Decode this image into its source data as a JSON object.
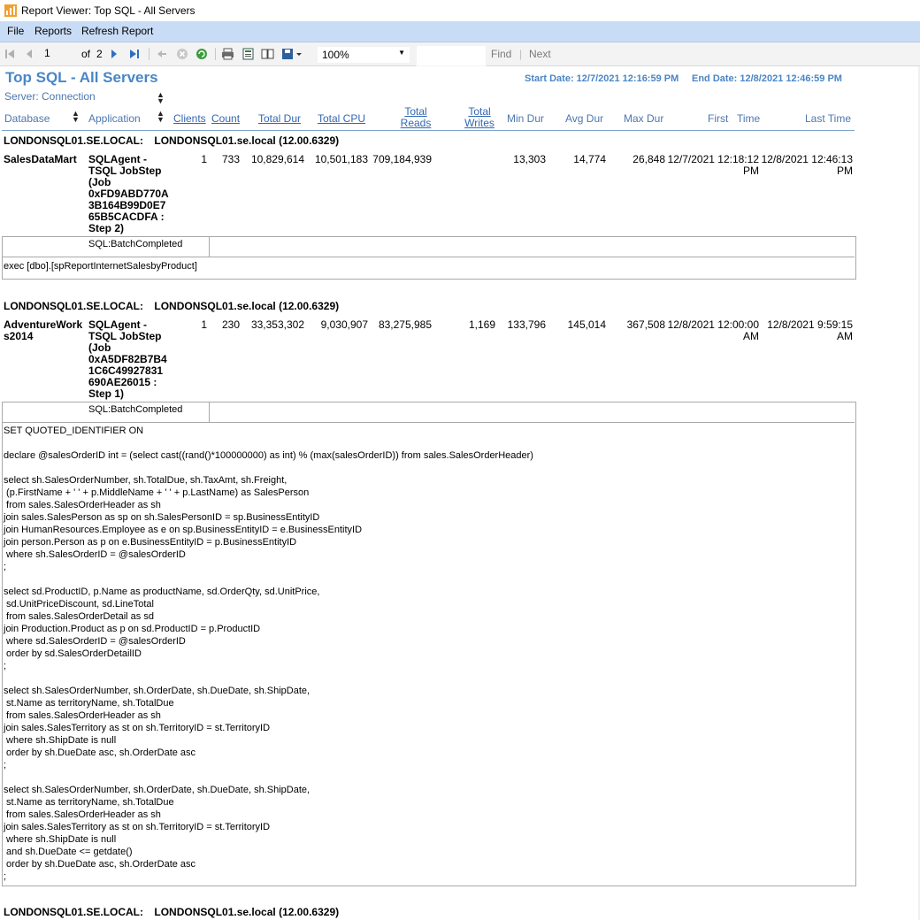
{
  "window": {
    "title": "Report Viewer: Top SQL - All Servers"
  },
  "menu": {
    "file": "File",
    "reports": "Reports",
    "refresh": "Refresh Report"
  },
  "toolbar": {
    "page_value": "1",
    "of_label": "of",
    "page_total": "2",
    "zoom": "100%",
    "find_value": "",
    "find": "Find",
    "sep": "|",
    "next": "Next",
    "icons": [
      "first-page-icon",
      "previous-page-icon",
      "next-page-icon",
      "last-page-icon",
      "back-icon",
      "stop-icon",
      "refresh-icon",
      "print-icon",
      "print-layout-icon",
      "page-setup-icon",
      "export-icon"
    ]
  },
  "report": {
    "title": "Top SQL - All Servers",
    "start_date": "Start Date: 12/7/2021 12:16:59 PM",
    "end_date": "End Date: 12/8/2021 12:46:59 PM",
    "server_header": "Server: Connection",
    "columns": {
      "database": "Database",
      "application": "Application",
      "clients": "Clients",
      "count": "Count",
      "total_dur": "Total Dur",
      "total_cpu": "Total CPU",
      "total_reads": [
        "Total",
        "Reads"
      ],
      "total_writes": [
        "Total",
        "Writes"
      ],
      "min_dur": "Min Dur",
      "avg_dur": "Avg Dur",
      "max_dur": "Max Dur",
      "first_time": [
        "First",
        "Time"
      ],
      "last_time": "Last Time"
    },
    "groups": [
      {
        "server": "LONDONSQL01.SE.LOCAL:",
        "connection": "LONDONSQL01.se.local (12.00.6329)",
        "database": "SalesDataMart",
        "application": [
          "SQLAgent -",
          "TSQL JobStep",
          "(Job",
          "0xFD9ABD770A",
          "3B164B99D0E7",
          "65B5CACDFA :",
          "Step 2)"
        ],
        "clients": "1",
        "count": "733",
        "total_dur": "10,829,614",
        "total_cpu": "10,501,183",
        "total_reads": "709,184,939",
        "total_writes": "",
        "min_dur": "13,303",
        "avg_dur": "14,774",
        "max_dur": "26,848",
        "first_time": [
          "12/7/2021 12:18:12",
          "PM"
        ],
        "last_time": [
          "12/8/2021 12:46:13",
          "PM"
        ],
        "event": "SQL:BatchCompleted",
        "sql": "exec [dbo].[spReportInternetSalesbyProduct]"
      },
      {
        "server": "LONDONSQL01.SE.LOCAL:",
        "connection": "LONDONSQL01.se.local (12.00.6329)",
        "database": [
          "AdventureWork",
          "s2014"
        ],
        "application": [
          "SQLAgent -",
          "TSQL JobStep",
          "(Job",
          "0xA5DF82B7B4",
          "1C6C49927831",
          "690AE26015 :",
          "Step 1)"
        ],
        "clients": "1",
        "count": "230",
        "total_dur": "33,353,302",
        "total_cpu": "9,030,907",
        "total_reads": "83,275,985",
        "total_writes": "1,169",
        "min_dur": "133,796",
        "avg_dur": "145,014",
        "max_dur": "367,508",
        "first_time": [
          "12/8/2021 12:00:00",
          "AM"
        ],
        "last_time": [
          "12/8/2021 9:59:15",
          "AM"
        ],
        "event": "SQL:BatchCompleted",
        "sql": "SET QUOTED_IDENTIFIER ON\n\ndeclare @salesOrderID int = (select cast((rand()*100000000) as int) % (max(salesOrderID)) from sales.SalesOrderHeader)\n\nselect sh.SalesOrderNumber, sh.TotalDue, sh.TaxAmt, sh.Freight,\n (p.FirstName + ' ' + p.MiddleName + ' ' + p.LastName) as SalesPerson\n from sales.SalesOrderHeader as sh\njoin sales.SalesPerson as sp on sh.SalesPersonID = sp.BusinessEntityID\njoin HumanResources.Employee as e on sp.BusinessEntityID = e.BusinessEntityID\njoin person.Person as p on e.BusinessEntityID = p.BusinessEntityID\n where sh.SalesOrderID = @salesOrderID\n;\n\nselect sd.ProductID, p.Name as productName, sd.OrderQty, sd.UnitPrice,\n sd.UnitPriceDiscount, sd.LineTotal\n from sales.SalesOrderDetail as sd\njoin Production.Product as p on sd.ProductID = p.ProductID\n where sd.SalesOrderID = @salesOrderID\n order by sd.SalesOrderDetailID\n;\n\nselect sh.SalesOrderNumber, sh.OrderDate, sh.DueDate, sh.ShipDate,\n st.Name as territoryName, sh.TotalDue\n from sales.SalesOrderHeader as sh\njoin sales.SalesTerritory as st on sh.TerritoryID = st.TerritoryID\n where sh.ShipDate is null\n order by sh.DueDate asc, sh.OrderDate asc\n;\n\nselect sh.SalesOrderNumber, sh.OrderDate, sh.DueDate, sh.ShipDate,\n st.Name as territoryName, sh.TotalDue\n from sales.SalesOrderHeader as sh\njoin sales.SalesTerritory as st on sh.TerritoryID = st.TerritoryID\n where sh.ShipDate is null\n and sh.DueDate <= getdate()\n order by sh.DueDate asc, sh.OrderDate asc\n;"
      },
      {
        "server": "LONDONSQL01.SE.LOCAL:",
        "connection": "LONDONSQL01.se.local (12.00.6329)"
      }
    ]
  }
}
